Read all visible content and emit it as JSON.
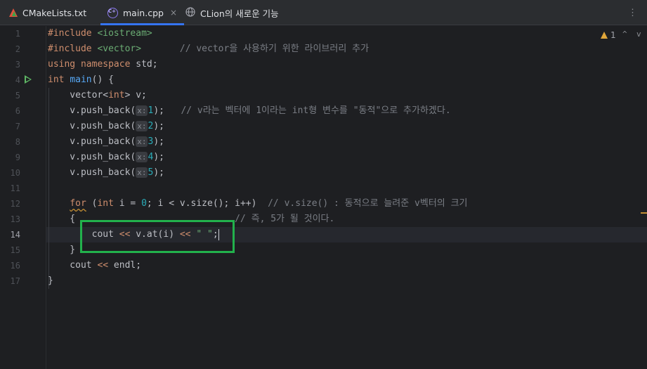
{
  "tabs": [
    {
      "label": "CMakeLists.txt",
      "icon": "cmake-icon",
      "active": false
    },
    {
      "label": "main.cpp",
      "icon": "cpp-file-icon",
      "active": true,
      "close": "×"
    },
    {
      "label": "CLion의 새로운 기능",
      "icon": "globe-icon",
      "active": false
    }
  ],
  "toolbar": {
    "more": "⋮"
  },
  "inspection": {
    "warning_count": "1",
    "up": "^",
    "down": "v"
  },
  "line_numbers": [
    "1",
    "2",
    "3",
    "4",
    "5",
    "6",
    "7",
    "8",
    "9",
    "10",
    "11",
    "12",
    "13",
    "14",
    "15",
    "16",
    "17"
  ],
  "current_line": "14",
  "code": {
    "l1_directive": "#include",
    "l1_header": "<iostream>",
    "l2_directive": "#include",
    "l2_header": "<vector>",
    "l2_comment": "// vector을 사용하기 위한 라이브러리 추가",
    "l3_using": "using",
    "l3_namespace": "namespace",
    "l3_std": " std;",
    "l4_int": "int",
    "l4_main": "main",
    "l4_rest": "() {",
    "l5_a": "    vector<",
    "l5_int": "int",
    "l5_b": "> v;",
    "push_prefix": "    v.push_back(",
    "hint_x": "x:",
    "push_values": [
      "1",
      "2",
      "3",
      "4",
      "5"
    ],
    "push_suffix": ");",
    "l6_comment": "// v라는 벡터에 1이라는 int형 변수를 \"동적\"으로 추가하겠다.",
    "l12_for": "for",
    "l12_a": " (",
    "l12_int": "int",
    "l12_b": " i = ",
    "l12_zero": "0",
    "l12_c": "; i < v.size(); i++)",
    "l12_comment": "// v.size() : 동적으로 늘려준 v벡터의 크기",
    "l13_brace": "    {",
    "l13_comment": "// 즉, 5가 될 것이다.",
    "l14_a": "        cout ",
    "l14_op1": "<<",
    "l14_b": " v.at(i) ",
    "l14_op2": "<<",
    "l14_str": "\" \"",
    "l14_semi": ";",
    "l15": "    }",
    "l16_a": "    cout ",
    "l16_op": "<<",
    "l16_b": " endl;",
    "l17": "}"
  },
  "colors": {
    "keyword": "#cf8e6d",
    "string": "#6aab73",
    "number": "#2aacb8",
    "function": "#56a8f5",
    "comment": "#7a7e85",
    "highlight": "#22b14c"
  }
}
